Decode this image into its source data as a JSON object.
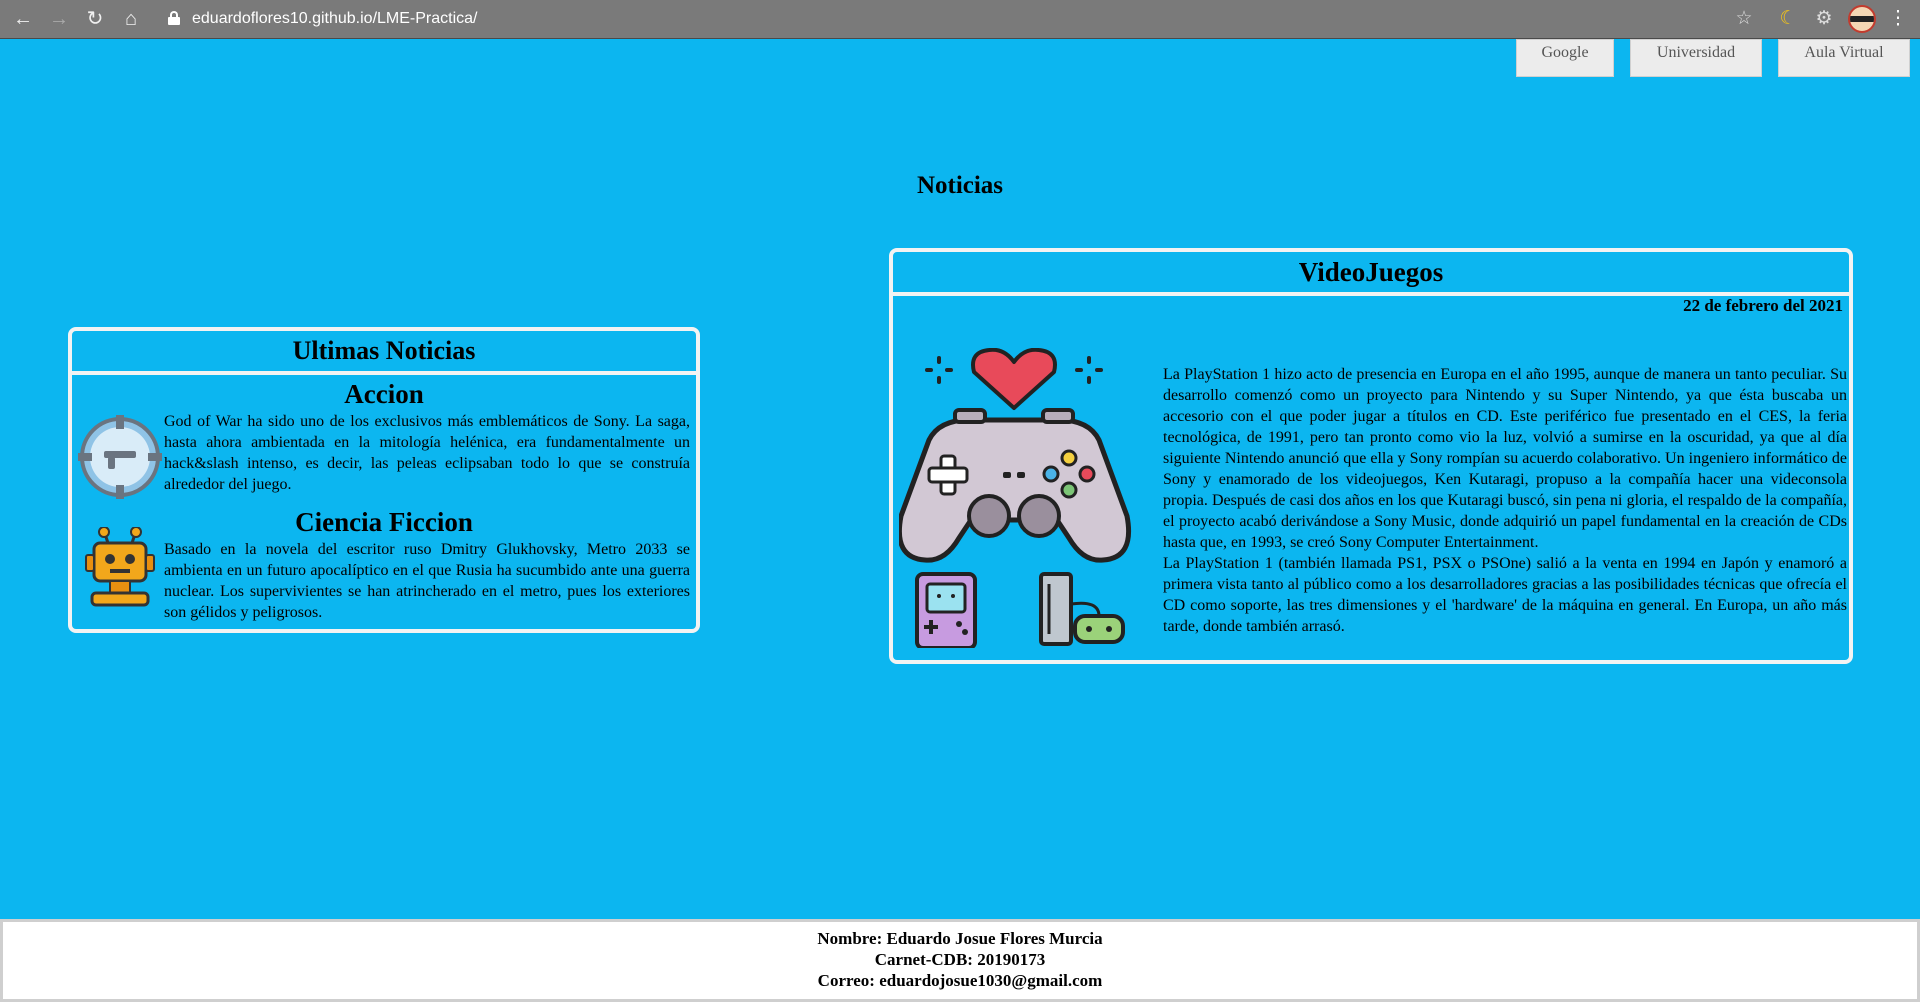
{
  "browser": {
    "url": "eduardoflores10.github.io/LME-Practica/",
    "back_icon": "arrow-left-icon",
    "forward_icon": "arrow-right-icon",
    "reload_icon": "reload-icon",
    "home_icon": "home-icon"
  },
  "top_links": [
    "Google",
    "Universidad",
    "Aula Virtual"
  ],
  "page_title": "Noticias",
  "news_box": {
    "title": "Ultimas Noticias",
    "sections": [
      {
        "title": "Accion",
        "icon": "crosshair-gun-icon",
        "text": "God of War ha sido uno de los exclusivos más emblemáticos de Sony. La saga, hasta ahora ambientada en la mitología helénica, era fundamentalmente un hack&slash intenso, es decir, las peleas eclipsaban todo lo que se construía alrededor del juego."
      },
      {
        "title": "Ciencia Ficcion",
        "icon": "robot-icon",
        "text": "Basado en la novela del escritor ruso Dmitry Glukhovsky, Metro 2033 se ambienta en un futuro apocalíptico en el que Rusia ha sucumbido ante una guerra nuclear. Los supervivientes se han atrincherado en el metro, pues los exteriores son gélidos y peligrosos."
      }
    ]
  },
  "games_box": {
    "title": "VideoJuegos",
    "date": "22 de febrero del 2021",
    "text_1": "La PlayStation 1 hizo acto de presencia en Europa en el año 1995, aunque de manera un tanto peculiar. Su desarrollo comenzó como un proyecto para Nintendo y su Super Nintendo, ya que ésta buscaba un accesorio con el que poder jugar a títulos en CD. Este periférico fue presentado en el CES, la feria tecnológica, de 1991, pero tan pronto como vio la luz, volvió a sumirse en la oscuridad, ya que al día siguiente Nintendo anunció que ella y Sony rompían su acuerdo colaborativo. Un ingeniero informático de Sony y enamorado de los videojuegos, Ken Kutaragi, propuso a la compañía hacer una videconsola propia. Después de casi dos años en los que Kutaragi buscó, sin pena ni gloria, el respaldo de la compañía, el proyecto acabó derivándose a Sony Music, donde adquirió un papel fundamental en la creación de CDs hasta que, en 1993, se creó Sony Computer Entertainment.",
    "text_2": "La PlayStation 1 (también llamada PS1, PSX o PSOne) salió a la venta en 1994 en Japón y enamoró a primera vista tanto al público como a los desarrolladores gracias a las posibilidades técnicas que ofrecía el CD como soporte, las tres dimensiones y el 'hardware' de la máquina en general. En Europa, un año más tarde, donde también arrasó.",
    "illustration": "gamepad-heart-icon"
  },
  "footer": {
    "line1": "Nombre: Eduardo Josue Flores Murcia",
    "line2": "Carnet-CDB: 20190173",
    "line3": "Correo: eduardojosue1030@gmail.com"
  }
}
